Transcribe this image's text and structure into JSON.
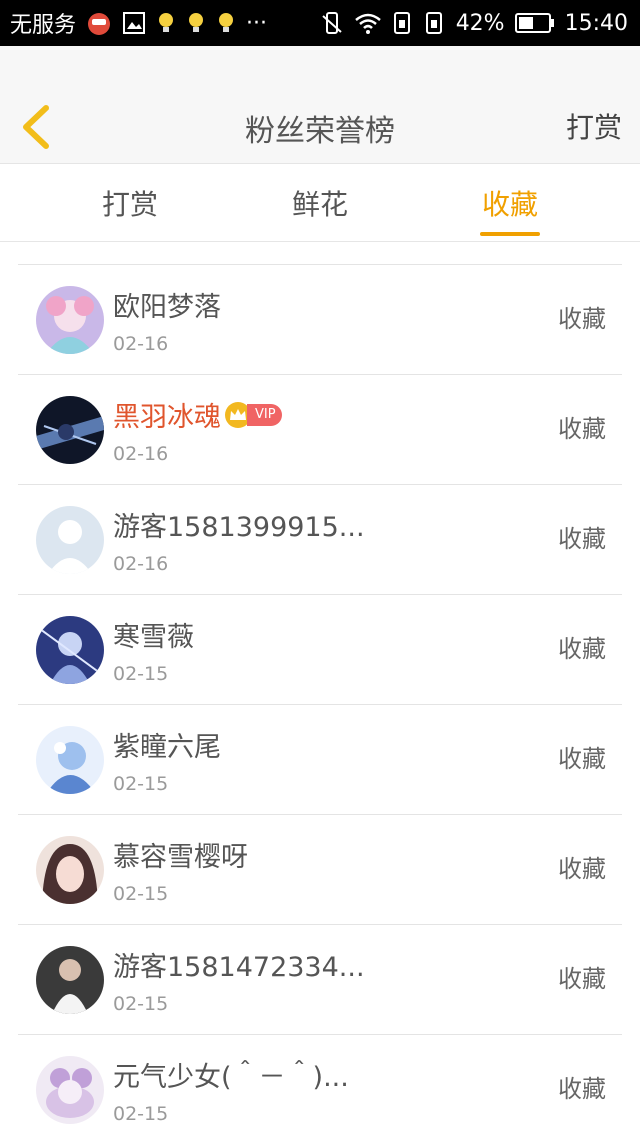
{
  "status_bar": {
    "carrier": "无服务",
    "battery": "42%",
    "time": "15:40",
    "more": "···"
  },
  "header": {
    "title": "粉丝荣誉榜",
    "action_label": "打赏"
  },
  "tabs": [
    {
      "label": "打赏",
      "active": false
    },
    {
      "label": "鲜花",
      "active": false
    },
    {
      "label": "收藏",
      "active": true
    }
  ],
  "fans": [
    {
      "name": "欧阳梦落",
      "date": "02-16",
      "action": "收藏",
      "vip": false,
      "avatar_color": "#c9b8e8"
    },
    {
      "name": "黑羽冰魂",
      "date": "02-16",
      "action": "收藏",
      "vip": true,
      "vip_label": "VIP",
      "avatar_color": "#1a2440"
    },
    {
      "name": "游客1581399915...",
      "date": "02-16",
      "action": "收藏",
      "vip": false,
      "avatar_color": "#dce6f0"
    },
    {
      "name": "寒雪薇",
      "date": "02-15",
      "action": "收藏",
      "vip": false,
      "avatar_color": "#3a4a90"
    },
    {
      "name": "紫瞳六尾",
      "date": "02-15",
      "action": "收藏",
      "vip": false,
      "avatar_color": "#a8c4ec"
    },
    {
      "name": "慕容雪樱呀",
      "date": "02-15",
      "action": "收藏",
      "vip": false,
      "avatar_color": "#e6cfc8"
    },
    {
      "name": "游客1581472334...",
      "date": "02-15",
      "action": "收藏",
      "vip": false,
      "avatar_color": "#4a4a4a"
    },
    {
      "name": "元气少女(＾－＾)...",
      "date": "02-15",
      "action": "收藏",
      "vip": false,
      "avatar_color": "#d8c2e6"
    }
  ],
  "colors": {
    "accent": "#f0a000",
    "vip_name": "#e0552d"
  }
}
